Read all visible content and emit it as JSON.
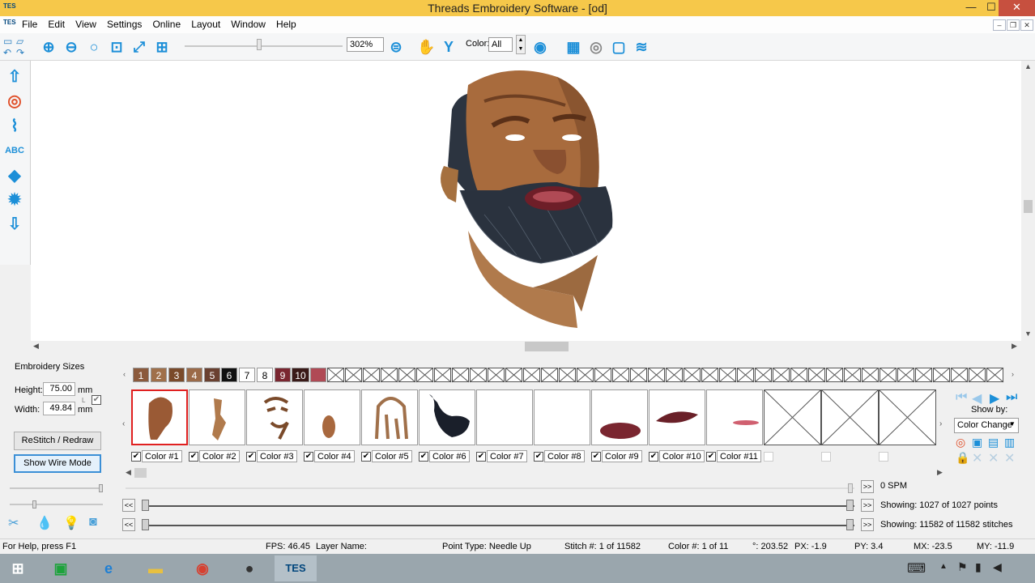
{
  "window": {
    "title": "Threads Embroidery Software - [od]",
    "app_icon_text": "TES",
    "minimize": "—",
    "maximize": "☐",
    "close": "✕"
  },
  "menu": {
    "items": [
      "File",
      "Edit",
      "View",
      "Settings",
      "Online",
      "Layout",
      "Window",
      "Help"
    ]
  },
  "toolbar": {
    "zoom_value": "302%",
    "color_label": "Color:",
    "color_value": "All"
  },
  "embroidery_sizes": {
    "title": "Embroidery Sizes",
    "height_label": "Height:",
    "height_value": "75.00",
    "height_unit": "mm",
    "width_label": "Width:",
    "width_value": "49.84",
    "width_unit": "mm",
    "lock_indicator": "L",
    "restitch_label": "ReStitch / Redraw",
    "wire_mode_label": "Show Wire Mode"
  },
  "swatches": [
    {
      "num": "1",
      "color": "#8b5a3c"
    },
    {
      "num": "2",
      "color": "#a0704a"
    },
    {
      "num": "3",
      "color": "#7a4a2a"
    },
    {
      "num": "4",
      "color": "#9b6a48"
    },
    {
      "num": "5",
      "color": "#6a4030"
    },
    {
      "num": "6",
      "color": "#111111"
    },
    {
      "num": "7",
      "color": "#ffffff"
    },
    {
      "num": "8",
      "color": "#ffffff"
    },
    {
      "num": "9",
      "color": "#7a2630"
    },
    {
      "num": "10",
      "color": "#3a1a18"
    },
    {
      "num": "",
      "color": "#b04a55"
    }
  ],
  "color_layers": [
    {
      "label": "Color #1",
      "checked": "✔"
    },
    {
      "label": "Color #2",
      "checked": "✔"
    },
    {
      "label": "Color #3",
      "checked": "✔"
    },
    {
      "label": "Color #4",
      "checked": "✔"
    },
    {
      "label": "Color #5",
      "checked": "✔"
    },
    {
      "label": "Color #6",
      "checked": "✔"
    },
    {
      "label": "Color #7",
      "checked": "✔"
    },
    {
      "label": "Color #8",
      "checked": "✔"
    },
    {
      "label": "Color #9",
      "checked": "✔"
    },
    {
      "label": "Color #10",
      "checked": "✔"
    },
    {
      "label": "Color #11",
      "checked": "✔"
    }
  ],
  "show_by": {
    "label": "Show by:",
    "value": "Color Change"
  },
  "playback": {
    "spm": "0 SPM",
    "points": "Showing: 1027 of 1027 points",
    "stitches": "Showing: 11582 of 11582 stitches",
    "prev_label": "<<",
    "next_label": ">>"
  },
  "status": {
    "help": "For Help, press F1",
    "fps": "FPS: 46.45",
    "layer": "Layer Name:",
    "point_type": "Point Type: Needle Up",
    "stitch": "Stitch #: 1 of 11582",
    "color": "Color #: 1 of 11",
    "angle": "°: 203.52",
    "px": "PX: -1.9",
    "py": "PY: 3.4",
    "mx": "MX: -23.5",
    "my": "MY: -11.9"
  },
  "taskbar": {
    "tes_label": "TES"
  }
}
